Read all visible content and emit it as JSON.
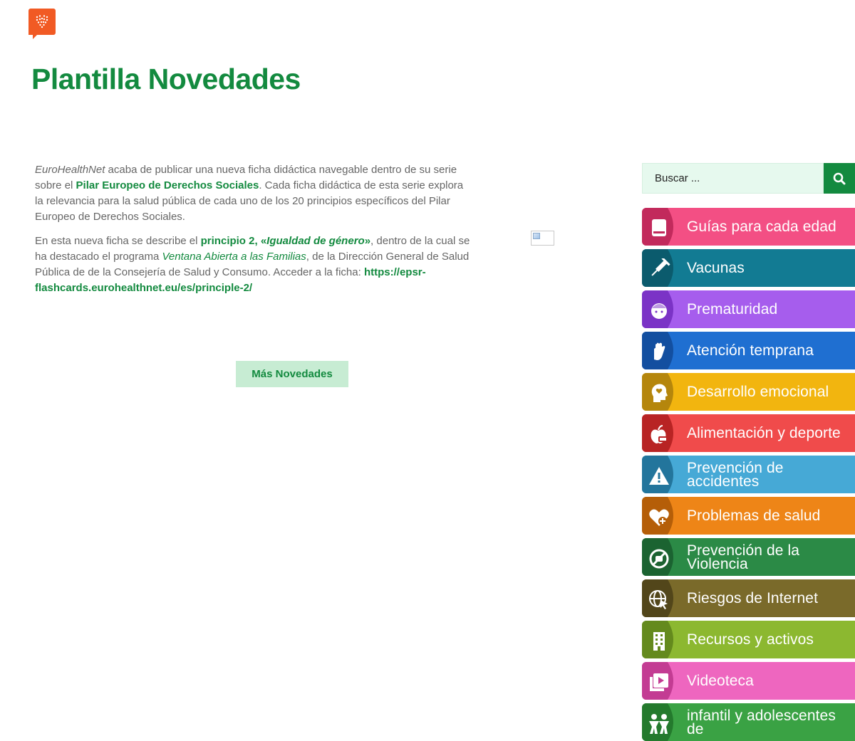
{
  "site": {
    "logo_icon": "heart-dots-logo-icon",
    "brand_color": "#f15a24"
  },
  "page": {
    "title": "Plantilla Novedades"
  },
  "article": {
    "p1": {
      "org": "EuroHealthNet",
      "text1": " acaba de publicar una nueva ficha didáctica navegable dentro de su serie sobre el ",
      "link": "Pilar Europeo de Derechos Sociales",
      "text2": ". Cada ficha didáctica de esta serie explora la relevancia para la salud pública de cada uno de los 20 principios específicos del Pilar Europeo de Derechos Sociales."
    },
    "p2": {
      "text1": "En esta nueva ficha se describe el ",
      "principle": "principio 2, «",
      "principle_name": "Igualdad de género",
      "principle_end": "»",
      "text2": ", dentro de la cual se ha destacado el programa ",
      "program": "Ventana Abierta a las Familias",
      "text3": ", de la Dirección General de Salud Pública de de la Consejería de Salud y Consumo.  Acceder a la ficha: ",
      "url": "https://epsr-flashcards.eurohealthnet.eu/es/principle-2/"
    },
    "more_button": "Más Novedades"
  },
  "sidebar": {
    "search": {
      "placeholder": "Buscar ...",
      "icon": "search-icon",
      "color": "#138a3f"
    },
    "menu": [
      {
        "label": "Guías para cada edad",
        "icon": "book-icon",
        "color": "#f34f84",
        "dark": "#c22a5c"
      },
      {
        "label": "Vacunas",
        "icon": "syringe-icon",
        "color": "#127b93",
        "dark": "#0b5b6d"
      },
      {
        "label": "Prematuridad",
        "icon": "baby-icon",
        "color": "#a65ded",
        "dark": "#7b33c6"
      },
      {
        "label": "Atención temprana",
        "icon": "hand-icon",
        "color": "#1f6fd1",
        "dark": "#134fa0"
      },
      {
        "label": "Desarrollo emocional",
        "icon": "head-heart-icon",
        "color": "#f2b50f",
        "dark": "#b5860c"
      },
      {
        "label": "Alimentación y deporte",
        "icon": "apple-icon",
        "color": "#f04b4b",
        "dark": "#b82424"
      },
      {
        "label": "Prevención de accidentes",
        "icon": "warning-icon",
        "color": "#46a9d6",
        "dark": "#23759c"
      },
      {
        "label": "Problemas de salud",
        "icon": "heart-plus-icon",
        "color": "#ee8517",
        "dark": "#b55e08"
      },
      {
        "label": "Prevención de la Violencia",
        "icon": "no-violence-icon",
        "color": "#2b8a46",
        "dark": "#1b6331"
      },
      {
        "label": "Riesgos de Internet",
        "icon": "globe-cursor-icon",
        "color": "#7a6a2a",
        "dark": "#52461a"
      },
      {
        "label": "Recursos y activos",
        "icon": "building-icon",
        "color": "#8cb830",
        "dark": "#648a1d"
      },
      {
        "label": "Videoteca",
        "icon": "video-icon",
        "color": "#ee66bf",
        "dark": "#c33c93"
      },
      {
        "label": "infantil y adolescentes de",
        "icon": "children-icon",
        "color": "#3aa244",
        "dark": "#247a2d"
      }
    ]
  }
}
